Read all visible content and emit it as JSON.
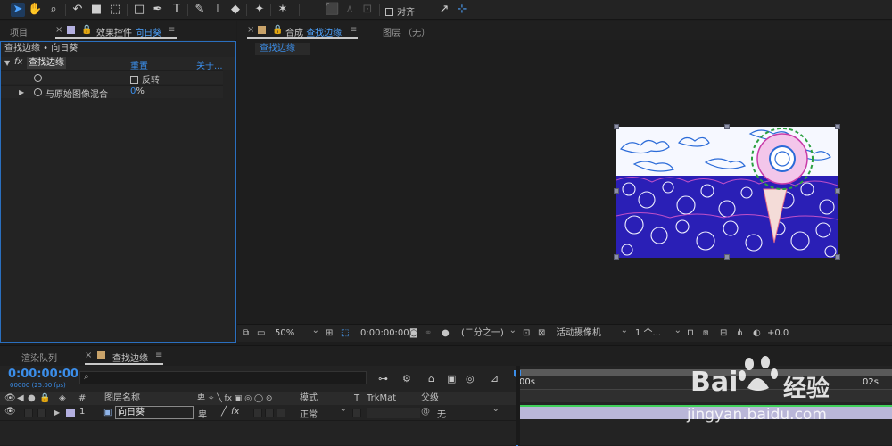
{
  "toolbar": {
    "align_label": "对齐"
  },
  "project_panel": {
    "tab_project": "项目",
    "tab_effects_prefix": "效果控件",
    "tab_effects_layer": "向日葵",
    "breadcrumb": "查找边缘 • 向日葵",
    "effect_name": "查找边缘",
    "reset": "重置",
    "about": "关于...",
    "fx_symbol": "fx",
    "invert_label": "反转",
    "blend_label": "与原始图像混合",
    "blend_value": "0",
    "blend_unit": "%"
  },
  "viewer": {
    "tab_comp_prefix": "合成",
    "tab_comp_name": "查找边缘",
    "tab_layer": "图层 （无）",
    "flow_tab": "查找边缘",
    "zoom": "50%",
    "timecode": "0:00:00:00",
    "resolution": "(二分之一)",
    "camera": "活动摄像机",
    "views": "1 个...",
    "exposure": "+0.0"
  },
  "timeline": {
    "tab_render": "渲染队列",
    "tab_comp": "查找边缘",
    "timecode": "0:00:00:00",
    "frame_info": "00000 (25.00 fps)",
    "search_placeholder": "",
    "ruler_start": "00s",
    "ruler_mark": "02s",
    "columns": {
      "hash": "#",
      "layer_name": "图层名称",
      "mode": "模式",
      "t": "T",
      "trkmat": "TrkMat",
      "parent": "父级"
    },
    "layer": {
      "number": "1",
      "name": "向日葵",
      "mode": "正常",
      "parent": "无"
    }
  },
  "watermark": {
    "brand": "Bai",
    "brand_cn": "经验",
    "url": "jingyan.baidu.com"
  },
  "colors": {
    "accent": "#3b8eea",
    "layer_label": "#b4b0e0",
    "track_green": "#3fd05a",
    "bar_lavender": "#b9b6d8"
  }
}
